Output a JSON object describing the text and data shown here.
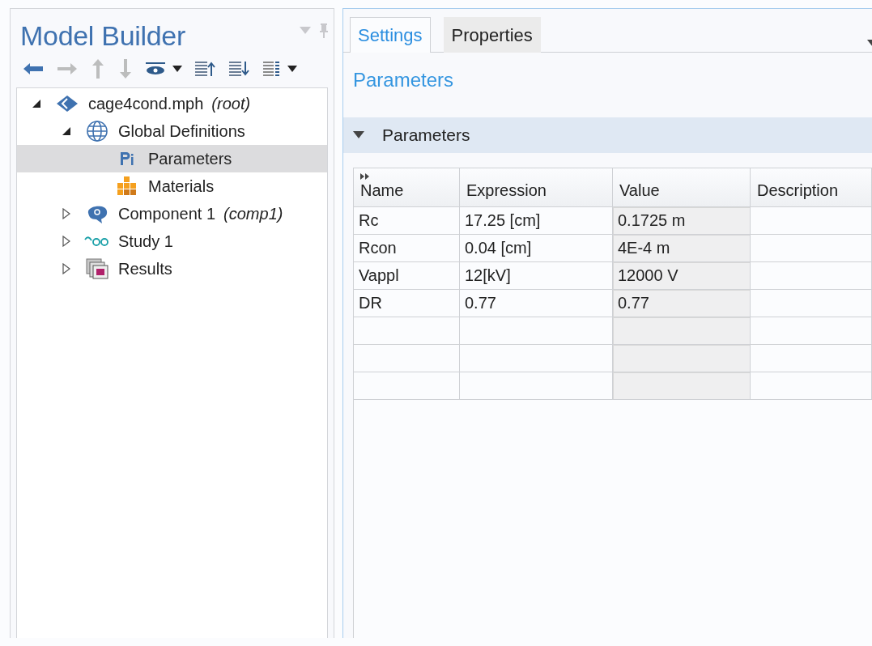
{
  "model_builder": {
    "title": "Model Builder",
    "toolbar": [
      {
        "kind": "back",
        "disabled": false
      },
      {
        "kind": "forward",
        "disabled": true
      },
      {
        "kind": "up",
        "disabled": true
      },
      {
        "kind": "down",
        "disabled": true
      },
      {
        "kind": "show",
        "disabled": false
      },
      {
        "kind": "collapse",
        "disabled": false
      },
      {
        "kind": "expand",
        "disabled": false
      },
      {
        "kind": "list",
        "disabled": false
      }
    ],
    "tree": [
      {
        "label": "cage4cond.mph",
        "note": "(root)",
        "kind": "model",
        "expanded": true,
        "selected": false,
        "children": [
          {
            "label": "Global Definitions",
            "kind": "globe",
            "expanded": true,
            "selected": false,
            "children": [
              {
                "label": "Parameters",
                "kind": "parameters",
                "selected": true
              },
              {
                "label": "Materials",
                "kind": "materials",
                "selected": false
              }
            ]
          },
          {
            "label": "Component 1",
            "note": "(comp1)",
            "kind": "component",
            "expanded": false,
            "selected": false
          },
          {
            "label": "Study 1",
            "kind": "study",
            "expanded": false,
            "selected": false
          },
          {
            "label": "Results",
            "kind": "results",
            "expanded": false,
            "selected": false
          }
        ]
      }
    ]
  },
  "settings": {
    "tabs": [
      {
        "label": "Settings",
        "selected": true
      },
      {
        "label": "Properties",
        "selected": false
      }
    ],
    "heading": "Parameters",
    "section": {
      "title": "Parameters",
      "expanded": true
    },
    "table": {
      "columns": [
        "Name",
        "Expression",
        "Value",
        "Description"
      ],
      "rows": [
        {
          "kind": "param",
          "name": "Rc",
          "expression": "17.25 [cm]",
          "value": "0.1725 m"
        },
        {
          "kind": "param",
          "name": "Rcon",
          "expression": "0.04 [cm]",
          "value": "4E-4 m"
        },
        {
          "kind": "param",
          "name": "Vappl",
          "expression": "12[kV]",
          "value": "12000 V"
        },
        {
          "kind": "param",
          "name": "DR",
          "expression": "0.77",
          "value": "0.77"
        },
        {
          "kind": "blank"
        },
        {
          "kind": "blank"
        },
        {
          "kind": "blank"
        }
      ]
    }
  }
}
